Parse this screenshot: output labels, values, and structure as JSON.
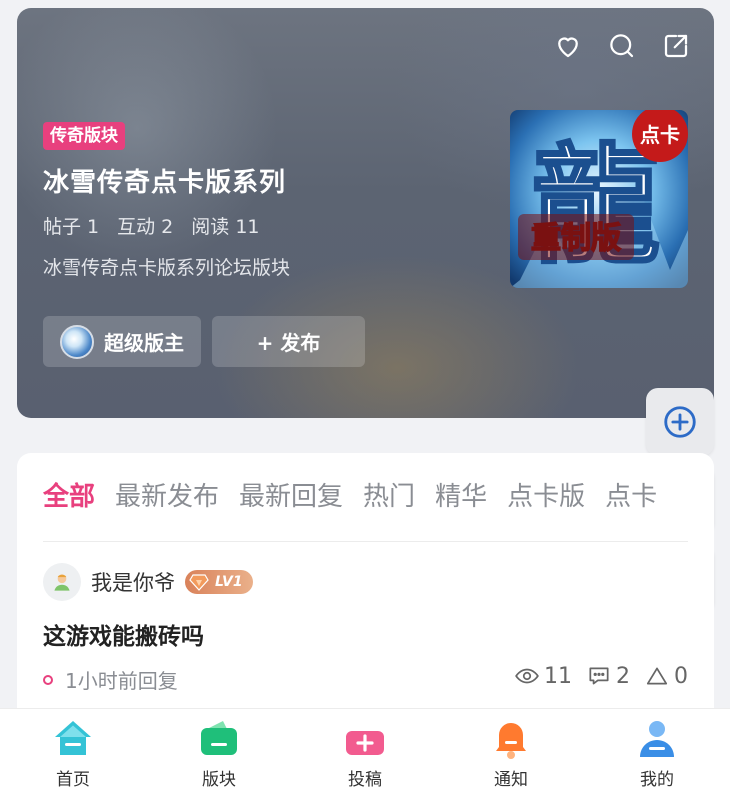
{
  "hero": {
    "tag": "传奇版块",
    "title": "冰雪传奇点卡版系列",
    "stats": {
      "posts": "帖子 1",
      "interactions": "互动 2",
      "reads": "阅读 11"
    },
    "description": "冰雪传奇点卡版系列论坛版块",
    "moderator_label": "超级版主",
    "post_button_label": "+ 发布",
    "cover": {
      "badge": "点卡",
      "overlay_text": "重制版",
      "glyph": "龍"
    }
  },
  "icons": {
    "favorite": "heart-icon",
    "search": "search-icon",
    "share": "share-icon"
  },
  "side_buttons": [
    "add-circle-icon",
    "wechat-icon",
    "moon-icon"
  ],
  "tabs": [
    {
      "label": "全部",
      "active": true
    },
    {
      "label": "最新发布",
      "active": false
    },
    {
      "label": "最新回复",
      "active": false
    },
    {
      "label": "热门",
      "active": false
    },
    {
      "label": "精华",
      "active": false
    },
    {
      "label": "点卡版",
      "active": false
    },
    {
      "label": "点卡",
      "active": false
    }
  ],
  "post": {
    "author": "我是你爷",
    "level": "LV1",
    "title": "这游戏能搬砖吗",
    "time": "1小时前回复",
    "views": "11",
    "comments": "2",
    "likes": "0"
  },
  "nav": [
    {
      "label": "首页",
      "icon": "home-icon"
    },
    {
      "label": "版块",
      "icon": "wallet-icon"
    },
    {
      "label": "投稿",
      "icon": "submit-icon"
    },
    {
      "label": "通知",
      "icon": "bell-icon"
    },
    {
      "label": "我的",
      "icon": "user-icon"
    }
  ],
  "colors": {
    "accent": "#e8407e",
    "blue": "#2d6bc7",
    "nav_cyan": "#34c3d6",
    "nav_green": "#1fbf7a",
    "nav_pink": "#f25b8f",
    "nav_orange": "#ff7a2f",
    "nav_blue": "#3a8ee6"
  }
}
